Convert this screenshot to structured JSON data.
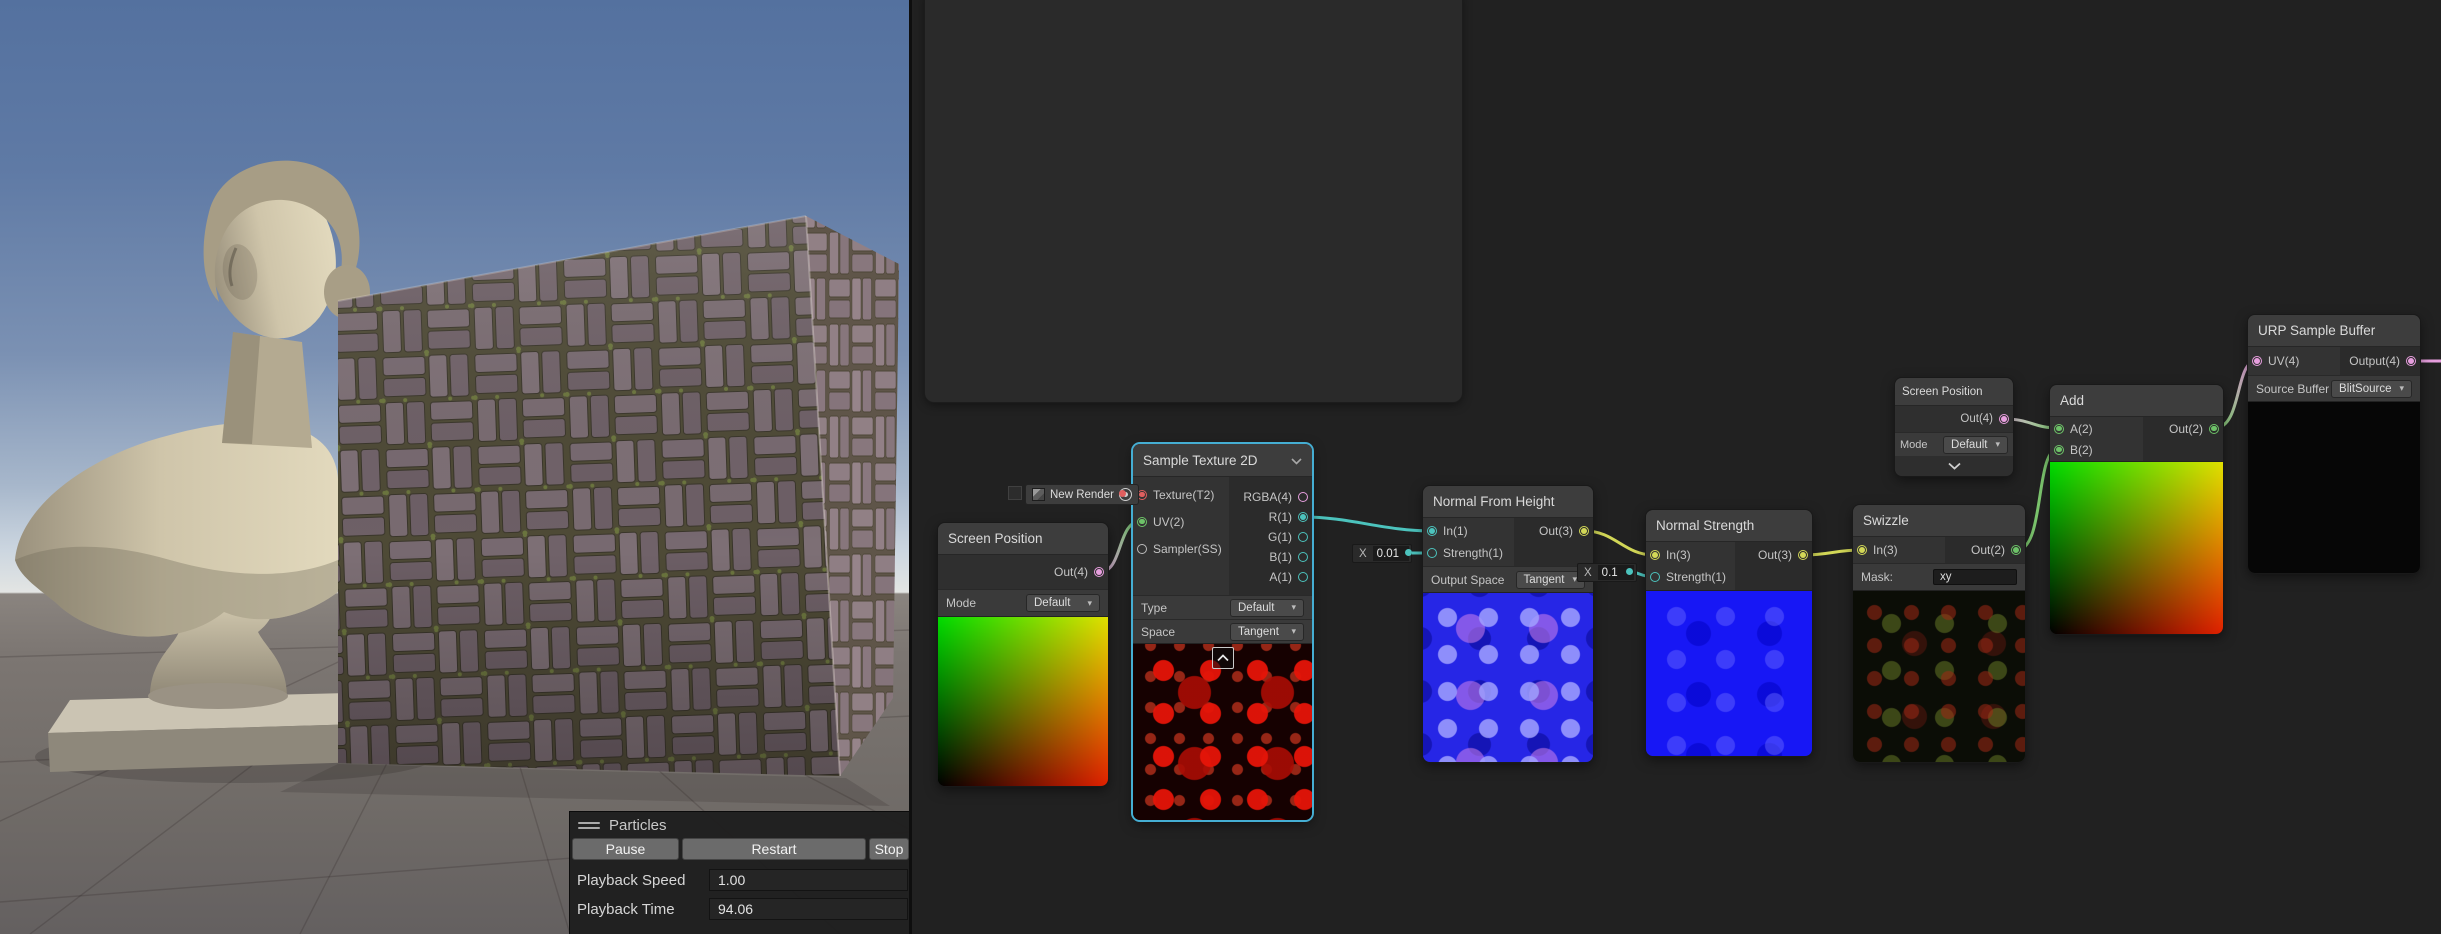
{
  "colors": {
    "vector1": "#4cc3bd",
    "vector2": "#6dc268",
    "vector3": "#d2d757",
    "vector4": "#e79ede",
    "texture2d": "#e05f5f",
    "sampler": "#bbbbbb",
    "selection": "#45aed3",
    "wire_red": "#e05f5f",
    "wire_pink": "#e79ede"
  },
  "scene": {
    "particles": {
      "title": "Particles",
      "buttons": [
        {
          "label": "Pause"
        },
        {
          "label": "Restart"
        },
        {
          "label": "Stop"
        }
      ],
      "playback_speed_label": "Playback Speed",
      "playback_speed_value": "1.00",
      "playback_time_label": "Playback Time",
      "playback_time_value": "94.06"
    }
  },
  "graph": {
    "texture_asset": {
      "name": "New Render"
    },
    "float_fields": [
      {
        "axis": "X",
        "value": "0.01"
      },
      {
        "axis": "X",
        "value": "0.1"
      }
    ],
    "nodes": {
      "screen_position_1": {
        "title": "Screen Position",
        "out": "Out(4)",
        "mode_label": "Mode",
        "mode_value": "Default"
      },
      "sample_texture_2d": {
        "title": "Sample Texture 2D",
        "inputs": [
          "Texture(T2)",
          "UV(2)",
          "Sampler(SS)"
        ],
        "outputs": [
          "RGBA(4)",
          "R(1)",
          "G(1)",
          "B(1)",
          "A(1)"
        ],
        "type_label": "Type",
        "type_value": "Default",
        "space_label": "Space",
        "space_value": "Tangent"
      },
      "normal_from_height": {
        "title": "Normal From Height",
        "in": "In(1)",
        "strength": "Strength(1)",
        "out": "Out(3)",
        "space_label": "Output Space",
        "space_value": "Tangent"
      },
      "normal_strength": {
        "title": "Normal Strength",
        "in": "In(3)",
        "strength": "Strength(1)",
        "out": "Out(3)"
      },
      "swizzle": {
        "title": "Swizzle",
        "in": "In(3)",
        "out": "Out(2)",
        "mask_label": "Mask:",
        "mask_value": "xy"
      },
      "screen_position_2": {
        "title": "Screen Position",
        "out": "Out(4)",
        "mode_label": "Mode",
        "mode_value": "Default"
      },
      "add": {
        "title": "Add",
        "a": "A(2)",
        "b": "B(2)",
        "out": "Out(2)"
      },
      "urp_sample_buffer": {
        "title": "URP Sample Buffer",
        "in": "UV(4)",
        "out": "Output(4)",
        "buffer_label": "Source Buffer",
        "buffer_value": "BlitSource"
      }
    }
  }
}
